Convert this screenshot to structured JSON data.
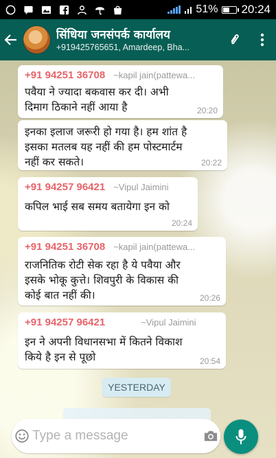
{
  "status_bar": {
    "battery_percent": "51%",
    "battery_level": 0.51,
    "time": "20:24",
    "icons_left": [
      "whatsapp-icon",
      "message-icon",
      "photo-icon",
      "facebook-icon",
      "user-icon",
      "umbrella-icon",
      "shop-icon"
    ]
  },
  "header": {
    "title": "सिंधिया जनसंपर्क कार्यालय",
    "subtitle": "+919425765651, Amardeep, Bha..."
  },
  "messages": [
    {
      "phone": "+91 94251 36708",
      "name": "~kapil jain(pattewa...",
      "text": "पवैया ने ज्यादा बकवास कर दी। अभी\nदिमाग ठिकाने नहीं आया है",
      "time": "20:20"
    },
    {
      "phone": "",
      "name": "",
      "text": "इनका इलाज जरूरी हो गया है। हम शांत है\nइसका मतलब यह नहीं की हम पोस्टमार्टम\nनहीं कर सकते।",
      "time": "20:22"
    },
    {
      "phone": "+91 94257 96421",
      "name": "~Vipul Jaimini",
      "text": "कपिल भाई सब समय बतायेगा इन को",
      "time": "20:24"
    },
    {
      "phone": "+91 94251 36708",
      "name": "~kapil jain(pattewa...",
      "text": "राजनितिक रोटी सेक रहा है ये पवैया और\nइसके भोकू कुत्ते। शिवपुरी के विकास की\nकोई बात नहीं की।",
      "time": "20:26"
    },
    {
      "phone": "+91 94257 96421",
      "name": "~Vipul Jaimini",
      "text": "इन ने अपनी विधानसभा में कितने विकाश\nकिये है  इन से पूछो",
      "time": "20:54"
    }
  ],
  "date_separator": "YESTERDAY",
  "composer": {
    "placeholder": "Type a message"
  },
  "colors": {
    "header_bg": "#075e54",
    "sender_phone": "#e7646a",
    "mic_button": "#0a8f7e",
    "date_chip_bg": "#d7ebf3"
  }
}
